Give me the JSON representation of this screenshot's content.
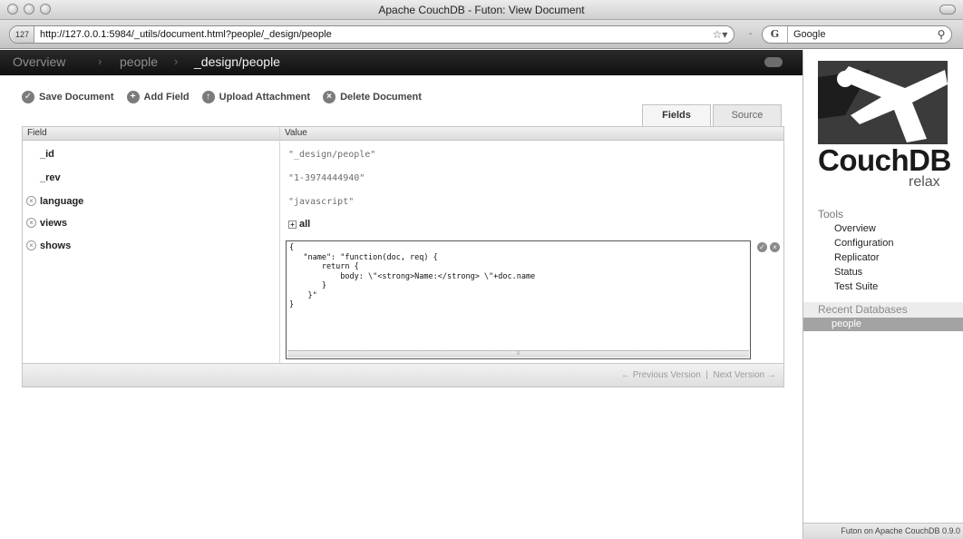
{
  "window": {
    "title": "Apache CouchDB - Futon: View Document"
  },
  "browser": {
    "site_badge": "127",
    "url": "http://127.0.0.1:5984/_utils/document.html?people/_design/people",
    "search_engine_glyph": "G",
    "search_text": "Google"
  },
  "breadcrumb": {
    "items": [
      "Overview",
      "people",
      "_design/people"
    ],
    "separator": "›"
  },
  "actions": {
    "save": "Save Document",
    "add_field": "Add Field",
    "upload": "Upload Attachment",
    "delete": "Delete Document"
  },
  "tabs": {
    "fields": "Fields",
    "source": "Source",
    "active": "Fields"
  },
  "table": {
    "headers": {
      "field": "Field",
      "value": "Value"
    },
    "rows": [
      {
        "field": "_id",
        "value": "\"_design/people\"",
        "deletable": false
      },
      {
        "field": "_rev",
        "value": "\"1-3974444940\"",
        "deletable": false
      },
      {
        "field": "language",
        "value": "\"javascript\"",
        "deletable": true
      },
      {
        "field": "views",
        "value": "all",
        "deletable": true,
        "expandable": true
      },
      {
        "field": "shows",
        "value": "",
        "deletable": true
      }
    ],
    "editor_text": "{\n   \"name\": \"function(doc, req) {\n       return {\n           body: \\\"<strong>Name:</strong> \\\"+doc.name\n       }\n    }\"\n}",
    "pagination": {
      "previous": "← Previous Version",
      "separator": "|",
      "next": "Next Version →"
    }
  },
  "sidebar": {
    "logo_word": "CouchDB",
    "logo_tagline": "relax",
    "tools_heading": "Tools",
    "tools": [
      "Overview",
      "Configuration",
      "Replicator",
      "Status",
      "Test Suite"
    ],
    "recent_heading": "Recent Databases",
    "recent": [
      "people"
    ],
    "footer": "Futon on Apache CouchDB 0.9.0"
  },
  "colors": {
    "breadcrumb_bg": "#1a1a1a",
    "selected_db_bg": "#a3a3a3"
  }
}
